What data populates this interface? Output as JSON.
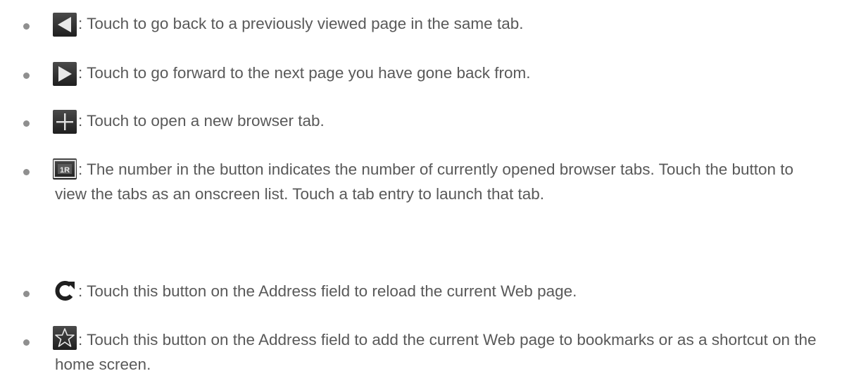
{
  "items": [
    {
      "icon": "back-triangle-icon",
      "text": ": Touch to go back to a previously viewed page in the same tab."
    },
    {
      "icon": "forward-triangle-icon",
      "text": ": Touch to go forward to the next page you have gone back from."
    },
    {
      "icon": "plus-icon",
      "text": ": Touch to open a new browser tab."
    },
    {
      "icon": "tabs-count-icon",
      "text": ": The number in the button indicates the number of currently opened browser tabs. Touch the button to view the tabs as an onscreen list. Touch a tab entry to launch that tab."
    },
    {
      "icon": "reload-icon",
      "text": ": Touch this button on the Address field to reload the current Web page."
    },
    {
      "icon": "star-icon",
      "text": ": Touch this button on the Address field to add the current Web page to bookmarks or as a shortcut on the home screen."
    }
  ],
  "colors": {
    "text": "#595959",
    "bullet": "#8f8f8f",
    "icon_dark": "#2a2a2a"
  }
}
